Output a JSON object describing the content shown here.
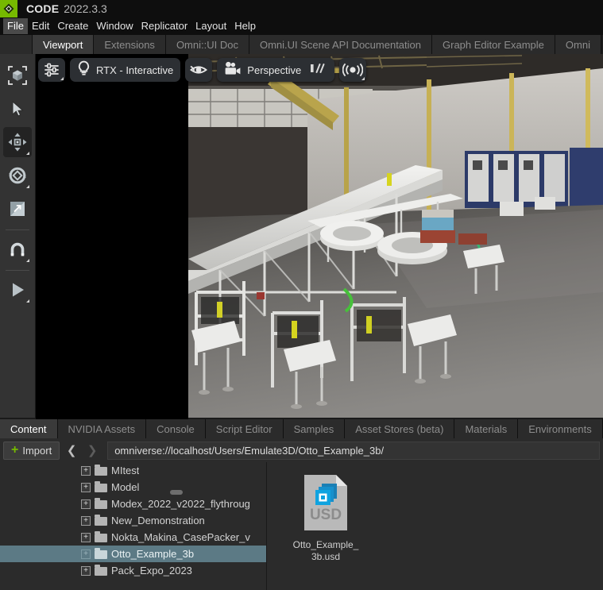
{
  "titlebar": {
    "logo_icon": "omniverse-diamond-logo",
    "app_name": "CODE",
    "version": "2022.3.3"
  },
  "menubar": {
    "items": [
      {
        "label": "File",
        "highlighted": true
      },
      {
        "label": "Edit"
      },
      {
        "label": "Create"
      },
      {
        "label": "Window"
      },
      {
        "label": "Replicator"
      },
      {
        "label": "Layout"
      },
      {
        "label": "Help"
      }
    ]
  },
  "top_tabs": [
    {
      "label": "Viewport",
      "active": true
    },
    {
      "label": "Extensions",
      "active": false
    },
    {
      "label": "Omni::UI Doc",
      "active": false
    },
    {
      "label": "Omni.UI Scene API Documentation",
      "active": false
    },
    {
      "label": "Graph Editor Example",
      "active": false
    },
    {
      "label": "Omni",
      "active": false
    }
  ],
  "tool_rail": {
    "tools": [
      {
        "name": "select-bounding-box-icon",
        "active": false,
        "has_corner": false
      },
      {
        "name": "select-cursor-icon",
        "active": false,
        "has_corner": false
      },
      {
        "name": "move-translate-icon",
        "active": true,
        "has_corner": true
      },
      {
        "name": "rotate-icon",
        "active": false,
        "has_corner": true
      },
      {
        "name": "scale-icon",
        "active": false,
        "has_corner": false
      },
      {
        "name": "snap-magnet-icon",
        "active": false,
        "has_corner": true
      },
      {
        "name": "play-icon",
        "active": false,
        "has_corner": true
      }
    ]
  },
  "viewport": {
    "settings_icon": "sliders-settings-icon",
    "render_mode": {
      "icon": "lightbulb-icon",
      "label": "RTX - Interactive"
    },
    "visibility_icon": "eye-visibility-icon",
    "camera": {
      "icon": "movie-camera-icon",
      "label": "Perspective"
    },
    "speed_icon": "camera-speed-icon",
    "audio_icon": "audio-waves-icon",
    "scene_description": "industrial warehouse with conveyor packaging line"
  },
  "bottom_tabs": [
    {
      "label": "Content",
      "active": true
    },
    {
      "label": "NVIDIA Assets",
      "active": false
    },
    {
      "label": "Console",
      "active": false
    },
    {
      "label": "Script Editor",
      "active": false
    },
    {
      "label": "Samples",
      "active": false
    },
    {
      "label": "Asset Stores (beta)",
      "active": false
    },
    {
      "label": "Materials",
      "active": false
    },
    {
      "label": "Environments",
      "active": false
    }
  ],
  "pathbar": {
    "import_label": "Import",
    "import_plus": "+",
    "back_icon": "chevron-left-icon",
    "forward_icon": "chevron-right-icon",
    "path": "omniverse://localhost/Users/Emulate3D/Otto_Example_3b/"
  },
  "file_tree": {
    "items": [
      {
        "label": "MItest",
        "selected": false,
        "expander": "+"
      },
      {
        "label": "Model",
        "selected": false,
        "expander": "+"
      },
      {
        "label": "Modex_2022_v2022_flythroug",
        "selected": false,
        "expander": "+"
      },
      {
        "label": "New_Demonstration",
        "selected": false,
        "expander": "+"
      },
      {
        "label": "Nokta_Makina_CasePacker_v",
        "selected": false,
        "expander": "+"
      },
      {
        "label": "Otto_Example_3b",
        "selected": true,
        "expander": "+"
      },
      {
        "label": "Pack_Expo_2023",
        "selected": false,
        "expander": "+"
      }
    ]
  },
  "asset_grid": {
    "items": [
      {
        "name": "Otto_Example_3b.usd",
        "icon": "usd-file-icon",
        "type": "USD"
      }
    ]
  },
  "colors": {
    "accent_green": "#76b900",
    "selection_blue": "#5c7a85",
    "panel_bg": "#2b2b2b",
    "tab_active": "#3a3a3a",
    "titlebar_bg": "#0e0e0e"
  }
}
